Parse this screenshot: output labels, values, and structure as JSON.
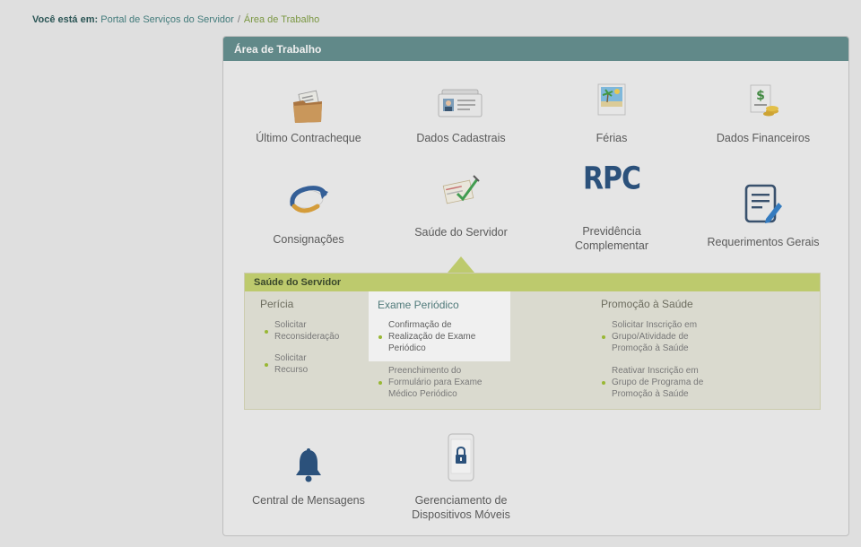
{
  "breadcrumb": {
    "prefix": "Você está em:",
    "portal": "Portal de Serviços do Servidor",
    "separator": "/",
    "current": "Área de Trabalho"
  },
  "panel": {
    "title": "Área de Trabalho",
    "tiles": [
      {
        "label": "Último Contracheque",
        "icon": "folder-document-icon"
      },
      {
        "label": "Dados Cadastrais",
        "icon": "id-cards-icon"
      },
      {
        "label": "Férias",
        "icon": "beach-photo-icon"
      },
      {
        "label": "Dados Financeiros",
        "icon": "money-bill-icon"
      },
      {
        "label": "Consignações",
        "icon": "orbit-arrow-icon"
      },
      {
        "label": "Saúde do Servidor",
        "icon": "clipboard-check-icon"
      },
      {
        "label": "Previdência Complementar",
        "icon": "rpc-logo-icon",
        "icon_text": "RPC"
      },
      {
        "label": "Requerimentos Gerais",
        "icon": "form-pencil-icon"
      },
      {
        "label": "Central de Mensagens",
        "icon": "bell-icon"
      },
      {
        "label": "Gerenciamento de Dispositivos Móveis",
        "icon": "mobile-lock-icon"
      }
    ]
  },
  "submenu": {
    "title": "Saúde do Servidor",
    "columns": [
      {
        "title": "Perícia",
        "links": [
          "Solicitar Reconsideração",
          "Solicitar Recurso"
        ]
      },
      {
        "title": "Exame Periódico",
        "links": [
          "Confirmação de Realização de Exame Periódico",
          "Preenchimento do Formulário para Exame Médico Periódico"
        ]
      },
      {
        "title": "Promoção à Saúde",
        "links": [
          "Solicitar Inscrição em Grupo/Atividade de Promoção à Saúde",
          "Reativar Inscrição em Grupo de Programa de Promoção à Saúde"
        ]
      }
    ]
  },
  "colors": {
    "header": "#5d8a8a",
    "submenu_header": "#c5d46a",
    "bullet": "#9cbf2a",
    "rpc": "#1f4a7a",
    "bell": "#1f4a7a"
  }
}
